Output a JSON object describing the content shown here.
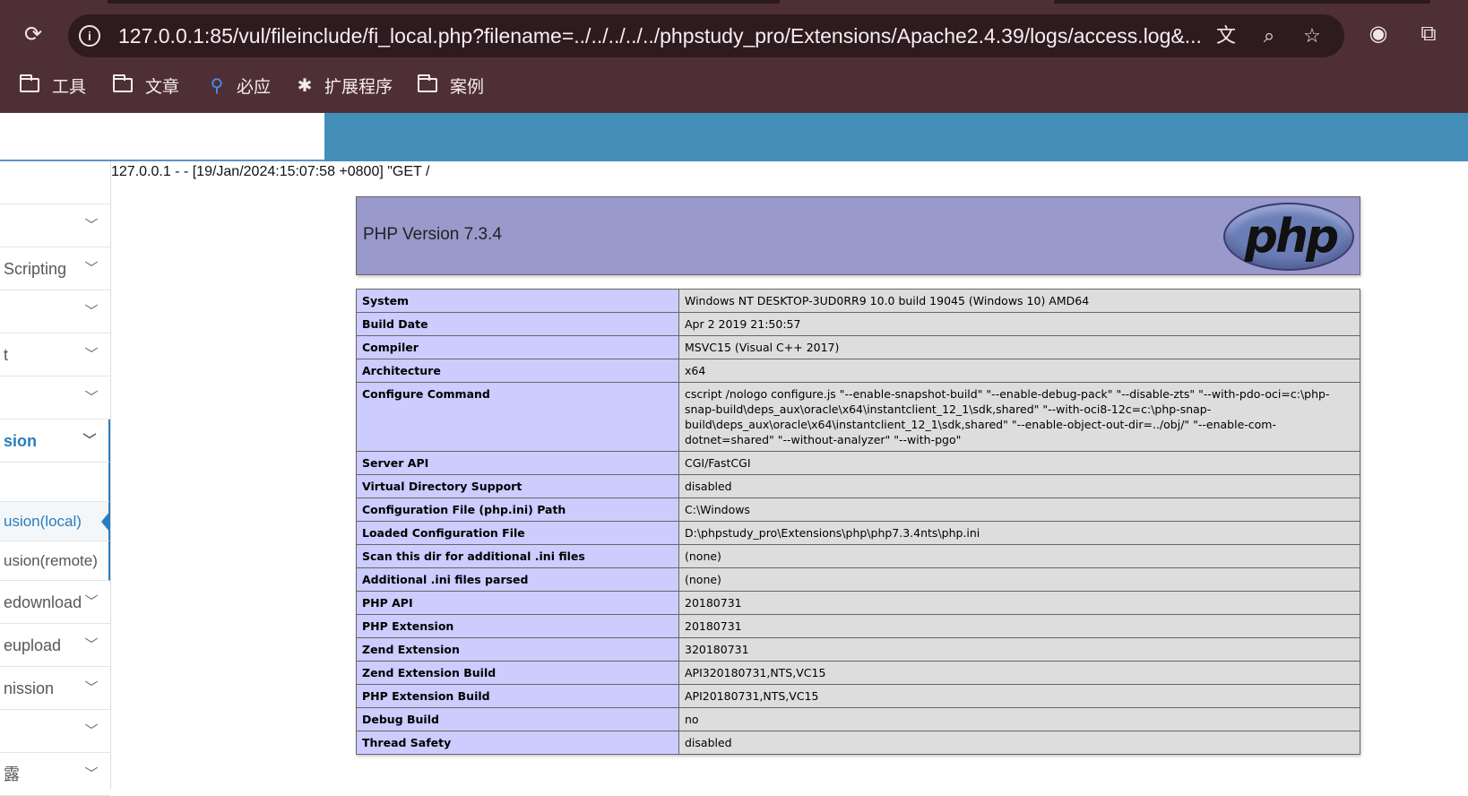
{
  "browser": {
    "url": "127.0.0.1:85/vul/fileinclude/fi_local.php?filename=../../../../../phpstudy_pro/Extensions/Apache2.4.39/logs/access.log&...",
    "icons": {
      "reload": "reload-icon",
      "site_info": "info-icon",
      "translate": "translate-icon",
      "zoom": "zoom-icon",
      "bookmark_star": "star-icon",
      "record": "record-icon",
      "extensions": "extensions-icon"
    }
  },
  "bookmarks": [
    {
      "label": "工具",
      "icon": "folder-icon"
    },
    {
      "label": "文章",
      "icon": "folder-icon"
    },
    {
      "label": "必应",
      "icon": "search-icon"
    },
    {
      "label": "扩展程序",
      "icon": "puzzle-icon"
    },
    {
      "label": "案例",
      "icon": "folder-icon"
    }
  ],
  "sidebar": {
    "items": [
      {
        "label": ""
      },
      {
        "label": ""
      },
      {
        "label": "Scripting"
      },
      {
        "label": ""
      },
      {
        "label": "t"
      },
      {
        "label": ""
      },
      {
        "label": "sion"
      },
      {
        "label": ""
      },
      {
        "label": "usion(local)"
      },
      {
        "label": "usion(remote)"
      },
      {
        "label": "edownload"
      },
      {
        "label": "eupload"
      },
      {
        "label": "nission"
      },
      {
        "label": ""
      },
      {
        "label": "露"
      }
    ]
  },
  "log_line": "127.0.0.1 - - [19/Jan/2024:15:07:58 +0800] \"GET /",
  "phpinfo": {
    "version_title": "PHP Version 7.3.4",
    "logo_text": "php",
    "rows": [
      {
        "name": "System",
        "value": "Windows NT DESKTOP-3UD0RR9 10.0 build 19045 (Windows 10) AMD64"
      },
      {
        "name": "Build Date",
        "value": "Apr 2 2019 21:50:57"
      },
      {
        "name": "Compiler",
        "value": "MSVC15 (Visual C++ 2017)"
      },
      {
        "name": "Architecture",
        "value": "x64"
      },
      {
        "name": "Configure Command",
        "value": "cscript /nologo configure.js \"--enable-snapshot-build\" \"--enable-debug-pack\" \"--disable-zts\" \"--with-pdo-oci=c:\\php-snap-build\\deps_aux\\oracle\\x64\\instantclient_12_1\\sdk,shared\" \"--with-oci8-12c=c:\\php-snap-build\\deps_aux\\oracle\\x64\\instantclient_12_1\\sdk,shared\" \"--enable-object-out-dir=../obj/\" \"--enable-com-dotnet=shared\" \"--without-analyzer\" \"--with-pgo\""
      },
      {
        "name": "Server API",
        "value": "CGI/FastCGI"
      },
      {
        "name": "Virtual Directory Support",
        "value": "disabled"
      },
      {
        "name": "Configuration File (php.ini) Path",
        "value": "C:\\Windows"
      },
      {
        "name": "Loaded Configuration File",
        "value": "D:\\phpstudy_pro\\Extensions\\php\\php7.3.4nts\\php.ini"
      },
      {
        "name": "Scan this dir for additional .ini files",
        "value": "(none)"
      },
      {
        "name": "Additional .ini files parsed",
        "value": "(none)"
      },
      {
        "name": "PHP API",
        "value": "20180731"
      },
      {
        "name": "PHP Extension",
        "value": "20180731"
      },
      {
        "name": "Zend Extension",
        "value": "320180731"
      },
      {
        "name": "Zend Extension Build",
        "value": "API320180731,NTS,VC15"
      },
      {
        "name": "PHP Extension Build",
        "value": "API20180731,NTS,VC15"
      },
      {
        "name": "Debug Build",
        "value": "no"
      },
      {
        "name": "Thread Safety",
        "value": "disabled"
      }
    ]
  }
}
